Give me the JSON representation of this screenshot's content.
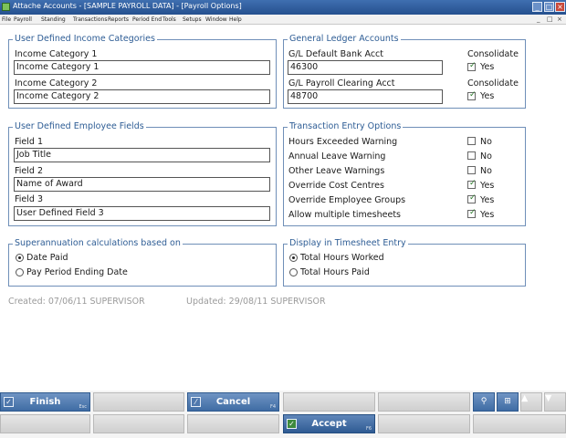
{
  "window": {
    "title": "Attache Accounts - [SAMPLE PAYROLL DATA] - [Payroll Options]",
    "controls": [
      "_",
      "□",
      "×"
    ]
  },
  "menu": {
    "items": [
      "File",
      "Payroll",
      "Standing",
      "Transactions",
      "Reports",
      "Period End",
      "Tools",
      "Setups",
      "Window",
      "Help"
    ],
    "right_controls": [
      "_",
      "□",
      "×"
    ]
  },
  "income_categories": {
    "legend": "User Defined Income Categories",
    "cat1_label": "Income Category 1",
    "cat1_value": "Income Category 1",
    "cat2_label": "Income Category 2",
    "cat2_value": "Income Category 2"
  },
  "gl_accounts": {
    "legend": "General Ledger Accounts",
    "bank_label": "G/L Default Bank Acct",
    "bank_value": "46300",
    "clearing_label": "G/L Payroll Clearing Acct",
    "clearing_value": "48700",
    "consolidate_label": "Consolidate",
    "bank_consolidate": "Yes",
    "clearing_consolidate": "Yes"
  },
  "employee_fields": {
    "legend": "User Defined Employee Fields",
    "field1_label": "Field 1",
    "field1_value": "Job Title",
    "field2_label": "Field 2",
    "field2_value": "Name of Award",
    "field3_label": "Field 3",
    "field3_value": "User Defined Field 3"
  },
  "transaction_options": {
    "legend": "Transaction Entry Options",
    "items": [
      {
        "label": "Hours Exceeded Warning",
        "checked": false,
        "value": "No"
      },
      {
        "label": "Annual Leave Warning",
        "checked": false,
        "value": "No"
      },
      {
        "label": "Other Leave Warnings",
        "checked": false,
        "value": "No"
      },
      {
        "label": "Override Cost Centres",
        "checked": true,
        "value": "Yes"
      },
      {
        "label": "Override Employee Groups",
        "checked": true,
        "value": "Yes"
      },
      {
        "label": "Allow multiple timesheets",
        "checked": true,
        "value": "Yes"
      }
    ]
  },
  "superannuation": {
    "legend": "Superannuation calculations based on",
    "option1": "Date Paid",
    "option2": "Pay Period Ending Date",
    "selected": "Date Paid"
  },
  "timesheet_display": {
    "legend": "Display in Timesheet Entry",
    "option1": "Total Hours Worked",
    "option2": "Total Hours Paid",
    "selected": "Total Hours Worked"
  },
  "meta": {
    "created": "Created: 07/06/11 SUPERVISOR",
    "updated": "Updated: 29/08/11 SUPERVISOR"
  },
  "buttons": {
    "finish": "Finish",
    "finish_key": "Esc",
    "cancel": "Cancel",
    "cancel_key": "F4",
    "accept": "Accept",
    "accept_key": "F6",
    "up_symbol": "▲",
    "down_symbol": "▼"
  },
  "colors": {
    "accent": "#2e5d95",
    "primary_button": "#3f6ca4",
    "check_mark": "#2c7a2c"
  }
}
